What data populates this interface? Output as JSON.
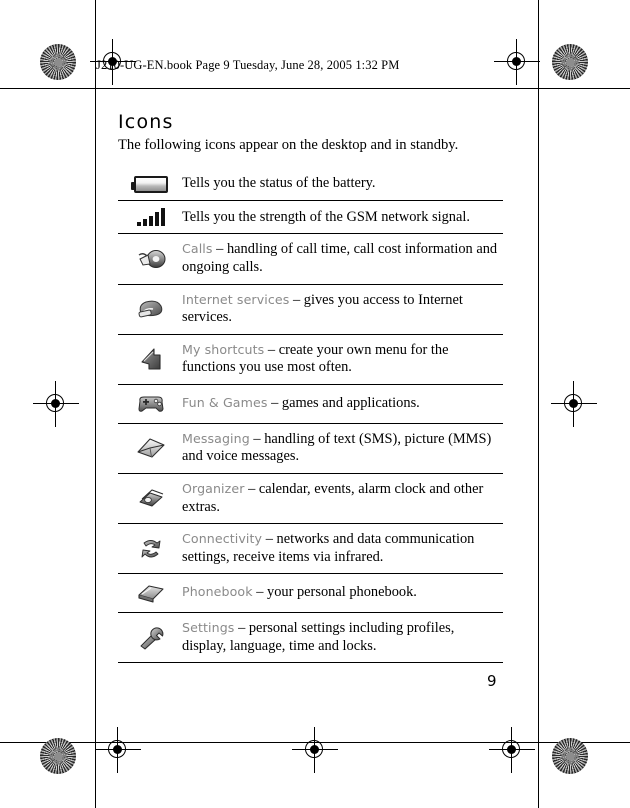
{
  "header": {
    "text": "J210-UG-EN.book  Page 9  Tuesday, June 28, 2005  1:32 PM"
  },
  "page": {
    "title": "Icons",
    "intro": "The following icons appear on the desktop and in standby.",
    "number": "9"
  },
  "colors": {
    "label": "#8a8a8a",
    "body": "#000000",
    "rule": "#000000"
  },
  "table": {
    "rows": [
      {
        "icon": "battery-icon",
        "label": "",
        "separator": "",
        "description": "Tells you the status of the battery."
      },
      {
        "icon": "signal-strength-icon",
        "label": "",
        "separator": "",
        "description": "Tells you the strength of the GSM network signal."
      },
      {
        "icon": "calls-icon",
        "label": "Calls",
        "separator": " – ",
        "description": "handling of call time, call cost information and ongoing calls."
      },
      {
        "icon": "internet-services-icon",
        "label": "Internet services",
        "separator": " – ",
        "description": "gives you access to Internet services."
      },
      {
        "icon": "my-shortcuts-icon",
        "label": "My shortcuts",
        "separator": " – ",
        "description": "create your own menu for the functions you use most often."
      },
      {
        "icon": "fun-and-games-icon",
        "label": "Fun & Games",
        "separator": " – ",
        "description": "games and applications."
      },
      {
        "icon": "messaging-icon",
        "label": "Messaging",
        "separator": " – ",
        "description": "handling of text (SMS), picture (MMS) and voice messages."
      },
      {
        "icon": "organizer-icon",
        "label": "Organizer",
        "separator": " – ",
        "description": "calendar, events, alarm clock and other extras."
      },
      {
        "icon": "connectivity-icon",
        "label": "Connectivity",
        "separator": " – ",
        "description": "networks and data communication settings, receive items via infrared."
      },
      {
        "icon": "phonebook-icon",
        "label": "Phonebook",
        "separator": " – ",
        "description": "your personal phonebook."
      },
      {
        "icon": "settings-icon",
        "label": "Settings",
        "separator": " – ",
        "description": "personal settings including profiles, display, language, time and locks."
      }
    ]
  }
}
